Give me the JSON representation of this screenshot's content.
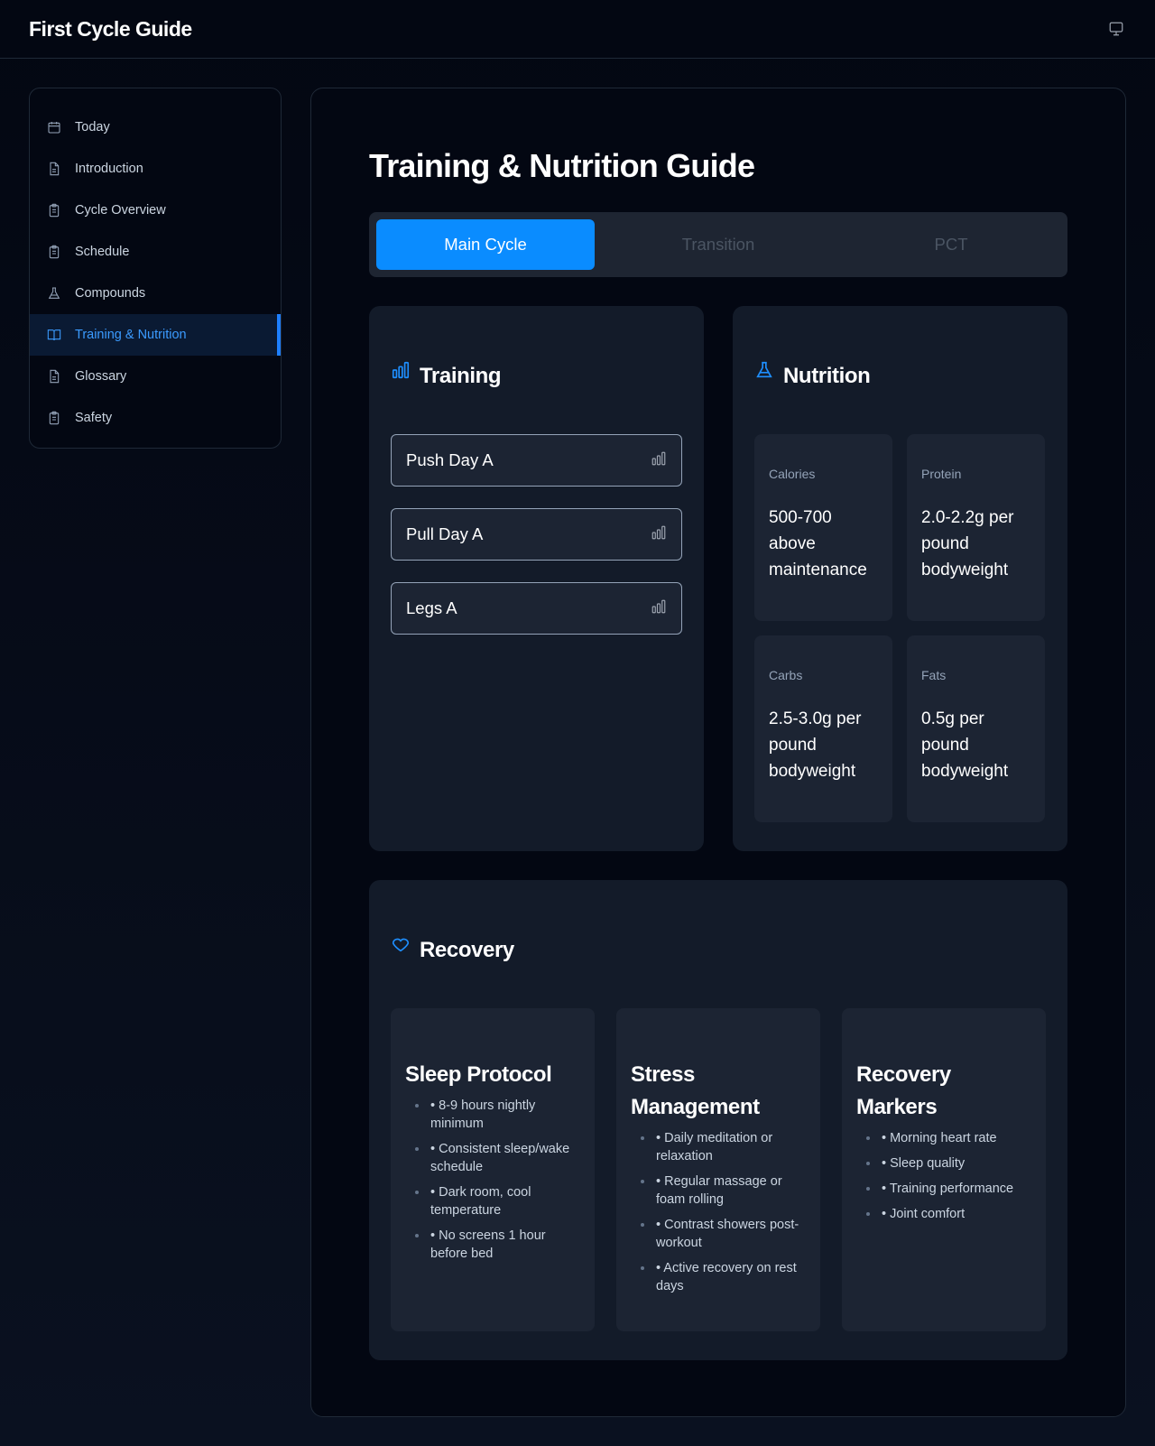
{
  "app": {
    "title": "First Cycle Guide"
  },
  "sidebar": {
    "items": [
      {
        "label": "Today",
        "icon": "calendar-icon"
      },
      {
        "label": "Introduction",
        "icon": "document-icon"
      },
      {
        "label": "Cycle Overview",
        "icon": "clipboard-icon"
      },
      {
        "label": "Schedule",
        "icon": "clipboard-icon"
      },
      {
        "label": "Compounds",
        "icon": "flask-icon"
      },
      {
        "label": "Training & Nutrition",
        "icon": "book-icon",
        "active": true
      },
      {
        "label": "Glossary",
        "icon": "document-icon"
      },
      {
        "label": "Safety",
        "icon": "clipboard-icon"
      }
    ]
  },
  "main": {
    "title": "Training & Nutrition Guide",
    "tabs": [
      {
        "label": "Main Cycle",
        "active": true
      },
      {
        "label": "Transition"
      },
      {
        "label": "PCT"
      }
    ],
    "training": {
      "title": "Training",
      "workouts": [
        "Push Day A",
        "Pull Day A",
        "Legs A"
      ]
    },
    "nutrition": {
      "title": "Nutrition",
      "macros": [
        {
          "label": "Calories",
          "value": "500-700 above maintenance"
        },
        {
          "label": "Protein",
          "value": "2.0-2.2g per pound bodyweight"
        },
        {
          "label": "Carbs",
          "value": "2.5-3.0g per pound bodyweight"
        },
        {
          "label": "Fats",
          "value": "0.5g per pound bodyweight"
        }
      ]
    },
    "recovery": {
      "title": "Recovery",
      "columns": [
        {
          "title": "Sleep Protocol",
          "items": [
            "• 8-9 hours nightly minimum",
            "• Consistent sleep/wake schedule",
            "• Dark room, cool temperature",
            "• No screens 1 hour before bed"
          ]
        },
        {
          "title": "Stress Management",
          "items": [
            "• Daily meditation or relaxation",
            "• Regular massage or foam rolling",
            "• Contrast showers post-workout",
            "• Active recovery on rest days"
          ]
        },
        {
          "title": "Recovery Markers",
          "items": [
            "• Morning heart rate",
            "• Sleep quality",
            "• Training performance",
            "• Joint comfort"
          ]
        }
      ]
    }
  },
  "colors": {
    "accent": "#0a8cff",
    "background": "#030712",
    "card": "#131b29"
  }
}
